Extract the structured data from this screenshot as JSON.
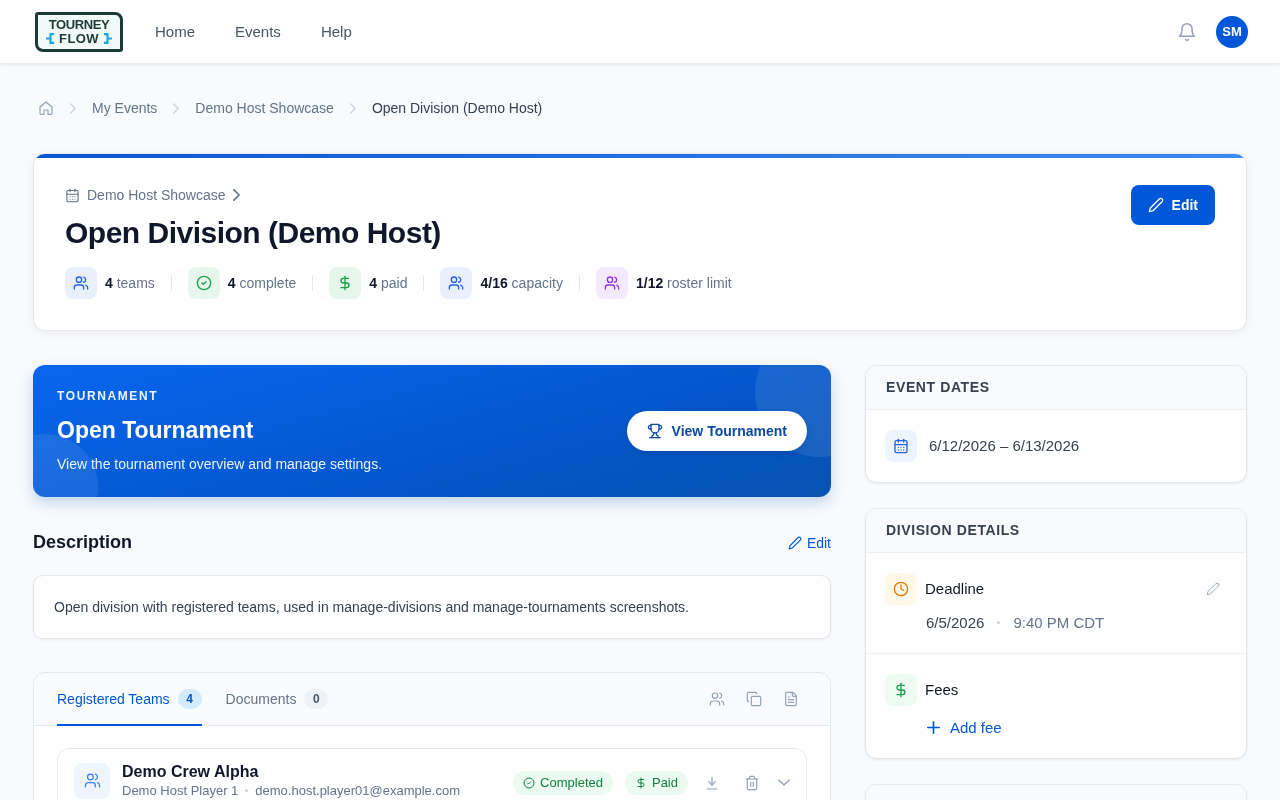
{
  "header": {
    "logo": {
      "top": "TOURNEY",
      "bottom": "FLOW"
    },
    "nav": [
      "Home",
      "Events",
      "Help"
    ],
    "avatar": "SM"
  },
  "breadcrumb": [
    "My Events",
    "Demo Host Showcase",
    "Open Division (Demo Host)"
  ],
  "division": {
    "event_link": "Demo Host Showcase",
    "title": "Open Division (Demo Host)",
    "edit_button": "Edit",
    "stats": [
      {
        "kind": "users",
        "value": "4",
        "label": "teams",
        "color": "#2563eb"
      },
      {
        "kind": "check",
        "value": "4",
        "label": "complete",
        "color": "#16a34a"
      },
      {
        "kind": "dollar",
        "value": "4",
        "label": "paid",
        "color": "#16a34a"
      },
      {
        "kind": "users",
        "value": "4/16",
        "label": "capacity",
        "color": "#2563eb"
      },
      {
        "kind": "users",
        "value": "1/12",
        "label": "roster limit",
        "color": "#9333ea"
      }
    ]
  },
  "tournament": {
    "eyebrow": "TOURNAMENT",
    "title": "Open Tournament",
    "subtitle": "View the tournament overview and manage settings.",
    "button": "View Tournament"
  },
  "description": {
    "heading": "Description",
    "edit_link": "Edit",
    "text": "Open division with registered teams, used in manage-divisions and manage-tournaments screenshots."
  },
  "teams_panel": {
    "tabs": [
      {
        "label": "Registered Teams",
        "count": "4",
        "selected": true
      },
      {
        "label": "Documents",
        "count": "0",
        "selected": false
      }
    ],
    "teams": [
      {
        "name": "Demo Crew Alpha",
        "captain": "Demo Host Player 1",
        "email": "demo.host.player01@example.com",
        "badges": [
          {
            "kind": "status",
            "label": "Completed"
          },
          {
            "kind": "payment",
            "label": "Paid"
          }
        ]
      }
    ]
  },
  "event_dates": {
    "heading": "EVENT DATES",
    "range": "6/12/2026 – 6/13/2026"
  },
  "division_details": {
    "heading": "DIVISION DETAILS",
    "deadline": {
      "label": "Deadline",
      "date": "6/5/2026",
      "time": "9:40 PM CDT"
    },
    "fees": {
      "label": "Fees",
      "add_link": "Add fee"
    }
  }
}
